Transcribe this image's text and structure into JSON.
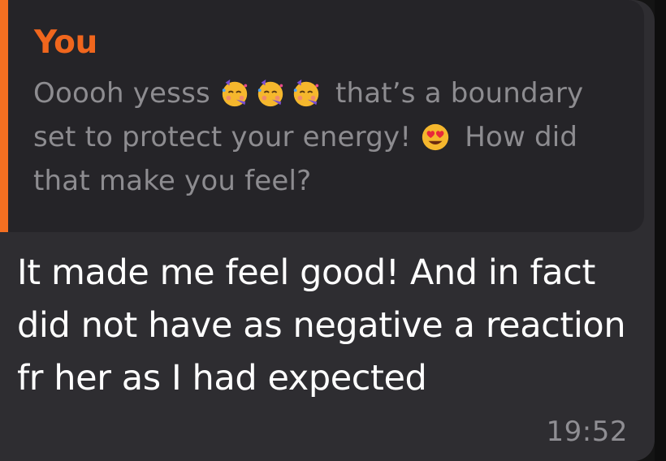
{
  "reply_quote": {
    "author": "You",
    "text_part1": "Ooooh yesss",
    "text_part2": "that’s a boundary set to protect your energy!",
    "text_part3": "How did that make you feel?",
    "emojis": [
      "partying-face",
      "partying-face",
      "partying-face",
      "heart-eyes-face"
    ]
  },
  "message": {
    "text": "It made me feel good! And in fact did not have as negative a reaction fr her as I had expected",
    "time": "19:52"
  },
  "colors": {
    "accent": "#f36f21",
    "bubble": "#2e2d31",
    "quote_bg": "#252428",
    "text": "#ffffff",
    "muted": "#8d8c90"
  }
}
